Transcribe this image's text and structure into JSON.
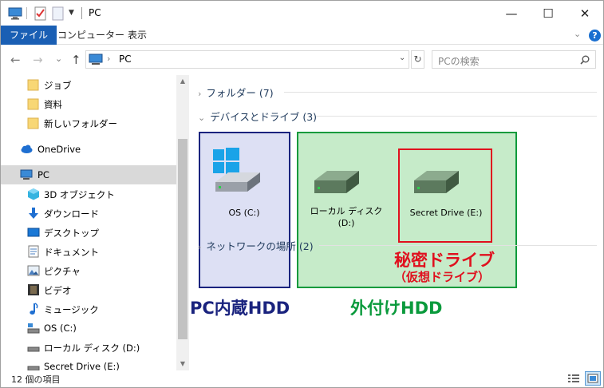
{
  "window": {
    "title": "PC",
    "minimize": "—",
    "maximize": "☐",
    "close": "✕"
  },
  "ribbon": {
    "tabs": [
      "ファイル",
      "コンピューター",
      "表示"
    ]
  },
  "nav": {
    "back": "←",
    "forward": "→",
    "recent": "⌄",
    "up": "↑",
    "address_path": "PC",
    "refresh": "↻",
    "search_placeholder": "PCの検索"
  },
  "sidebar": {
    "items": [
      {
        "label": "ジョブ",
        "icon": "folder-icon"
      },
      {
        "label": "資料",
        "icon": "folder-icon"
      },
      {
        "label": "新しいフォルダー",
        "icon": "folder-icon"
      },
      {
        "label": "OneDrive",
        "icon": "cloud-icon"
      },
      {
        "label": "PC",
        "icon": "computer-icon"
      },
      {
        "label": "3D オブジェクト",
        "icon": "cube-icon"
      },
      {
        "label": "ダウンロード",
        "icon": "download-icon"
      },
      {
        "label": "デスクトップ",
        "icon": "desktop-icon"
      },
      {
        "label": "ドキュメント",
        "icon": "document-icon"
      },
      {
        "label": "ピクチャ",
        "icon": "picture-icon"
      },
      {
        "label": "ビデオ",
        "icon": "video-icon"
      },
      {
        "label": "ミュージック",
        "icon": "music-icon"
      },
      {
        "label": "OS (C:)",
        "icon": "drive-icon"
      },
      {
        "label": "ローカル ディスク (D:)",
        "icon": "drive-icon"
      },
      {
        "label": "Secret Drive (E:)",
        "icon": "drive-icon"
      }
    ]
  },
  "content": {
    "groups": [
      {
        "label": "フォルダー (7)"
      },
      {
        "label": "デバイスとドライブ (3)"
      },
      {
        "label": "ネットワークの場所 (2)"
      }
    ],
    "drives": [
      {
        "label": "OS (C:)"
      },
      {
        "label": "ローカル ディスク\n(D:)"
      },
      {
        "label": "Secret Drive (E:)"
      }
    ]
  },
  "annotations": {
    "internal_hdd": "PC内蔵HDD",
    "external_hdd": "外付けHDD",
    "secret_drive": "秘密ドライブ",
    "virtual_drive": "（仮想ドライブ）",
    "colors": {
      "internal": "#1a237e",
      "external": "#0a9a3c",
      "secret": "#e0101e"
    }
  },
  "status": {
    "item_count": "12 個の項目"
  }
}
